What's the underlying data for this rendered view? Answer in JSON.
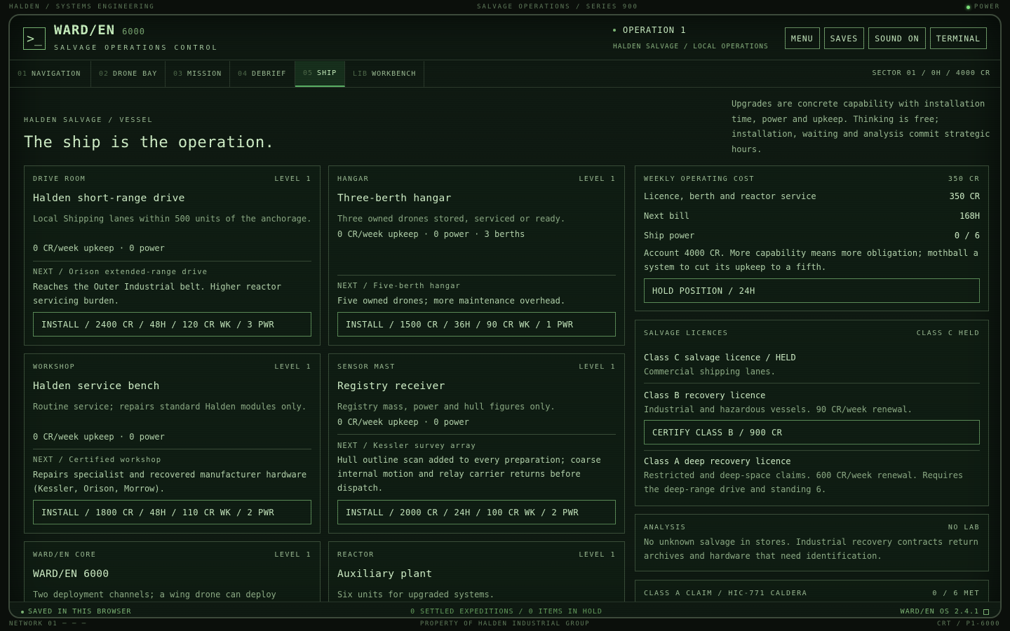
{
  "topbar": {
    "left": "HALDEN / SYSTEMS ENGINEERING",
    "center": "SALVAGE OPERATIONS / SERIES 900",
    "right": "POWER"
  },
  "bottombar": {
    "left": "NETWORK 01 ─ ─ ─",
    "center": "PROPERTY OF HALDEN INDUSTRIAL GROUP",
    "right": "CRT / P1-6000"
  },
  "header": {
    "logo_glyph": ">_",
    "name": "WARD/EN",
    "model": "6000",
    "subtitle": "SALVAGE OPERATIONS CONTROL",
    "operation": "OPERATION 1",
    "operation_sub": "HALDEN SALVAGE / LOCAL OPERATIONS",
    "buttons": {
      "menu": "MENU",
      "saves": "SAVES",
      "sound": "SOUND ON",
      "terminal": "TERMINAL"
    }
  },
  "tabs": [
    {
      "num": "01",
      "label": "NAVIGATION"
    },
    {
      "num": "02",
      "label": "DRONE BAY"
    },
    {
      "num": "03",
      "label": "MISSION"
    },
    {
      "num": "04",
      "label": "DEBRIEF"
    },
    {
      "num": "05",
      "label": "SHIP"
    },
    {
      "num": "LIB",
      "label": "WORKBENCH"
    }
  ],
  "sector": "SECTOR 01 / 0H / 4000 CR",
  "page": {
    "eyebrow": "HALDEN SALVAGE / VESSEL",
    "headline": "The ship is the operation.",
    "intro": "Upgrades are concrete capability with installation time, power and upkeep. Thinking is free; installation, waiting and analysis commit strategic hours."
  },
  "modules": {
    "drive": {
      "kicker": "DRIVE ROOM",
      "level": "LEVEL 1",
      "title": "Halden short-range drive",
      "desc": "Local Shipping lanes within 500 units of the anchorage.",
      "meta": "0 CR/week upkeep · 0 power",
      "next": "NEXT / Orison extended-range drive",
      "next_desc": "Reaches the Outer Industrial belt. Higher reactor servicing burden.",
      "action": "INSTALL / 2400 CR / 48H / 120 CR WK / 3 PWR"
    },
    "hangar": {
      "kicker": "HANGAR",
      "level": "LEVEL 1",
      "title": "Three-berth hangar",
      "desc": "Three owned drones stored, serviced or ready.",
      "meta": "0 CR/week upkeep · 0 power · 3 berths",
      "next": "NEXT / Five-berth hangar",
      "next_desc": "Five owned drones; more maintenance overhead.",
      "action": "INSTALL / 1500 CR / 36H / 90 CR WK / 1 PWR"
    },
    "workshop": {
      "kicker": "WORKSHOP",
      "level": "LEVEL 1",
      "title": "Halden service bench",
      "desc": "Routine service; repairs standard Halden modules only.",
      "meta": "0 CR/week upkeep · 0 power",
      "next": "NEXT / Certified workshop",
      "next_desc": "Repairs specialist and recovered manufacturer hardware (Kessler, Orison, Morrow).",
      "action": "INSTALL / 1800 CR / 48H / 110 CR WK / 2 PWR"
    },
    "sensor": {
      "kicker": "SENSOR MAST",
      "level": "LEVEL 1",
      "title": "Registry receiver",
      "desc": "Registry mass, power and hull figures only.",
      "meta": "0 CR/week upkeep · 0 power",
      "next": "NEXT / Kessler survey array",
      "next_desc": "Hull outline scan added to every preparation; coarse internal motion and relay carrier returns before dispatch.",
      "action": "INSTALL / 2000 CR / 24H / 100 CR WK / 2 PWR"
    },
    "core": {
      "kicker": "WARD/EN CORE",
      "level": "LEVEL 1",
      "title": "WARD/EN 6000",
      "desc": "Two deployment channels; a wing drone can deploy"
    },
    "reactor": {
      "kicker": "REACTOR",
      "level": "LEVEL 1",
      "title": "Auxiliary plant",
      "desc": "Six units for upgraded systems."
    }
  },
  "weekly": {
    "kicker": "WEEKLY OPERATING COST",
    "kicker_value": "350 CR",
    "rows": [
      {
        "label": "Licence, berth and reactor service",
        "value": "350 CR"
      },
      {
        "label": "Next bill",
        "value": "168H"
      },
      {
        "label": "Ship power",
        "value": "0 / 6"
      }
    ],
    "note": "Account 4000 CR. More capability means more obligation; mothball a system to cut its upkeep to a fifth.",
    "action": "HOLD POSITION / 24H"
  },
  "licences": {
    "kicker": "SALVAGE LICENCES",
    "kicker_value": "CLASS C HELD",
    "c_title": "Class C salvage licence / HELD",
    "c_desc": "Commercial shipping lanes.",
    "b_title": "Class B recovery licence",
    "b_desc": "Industrial and hazardous vessels. 90 CR/week renewal.",
    "b_action": "CERTIFY CLASS B / 900 CR",
    "a_title": "Class A deep recovery licence",
    "a_desc": "Restricted and deep-space claims. 600 CR/week renewal. Requires the deep-range drive and standing 6."
  },
  "analysis": {
    "kicker": "ANALYSIS",
    "kicker_value": "NO LAB",
    "desc": "No unknown salvage in stores. Industrial recovery contracts return archives and hardware that need identification."
  },
  "claim": {
    "kicker": "CLASS A CLAIM / HIC-771 CALDERA",
    "kicker_value": "0 / 6 MET"
  },
  "footer": {
    "left": "SAVED IN THIS BROWSER",
    "center": "0 SETTLED EXPEDITIONS / 0 ITEMS IN HOLD",
    "right": "WARD/EN OS 2.4.1"
  },
  "colors": {
    "accent": "#7be07a",
    "text": "#b9d8b3",
    "border": "#3a4e39",
    "bg": "#0f1a12"
  }
}
